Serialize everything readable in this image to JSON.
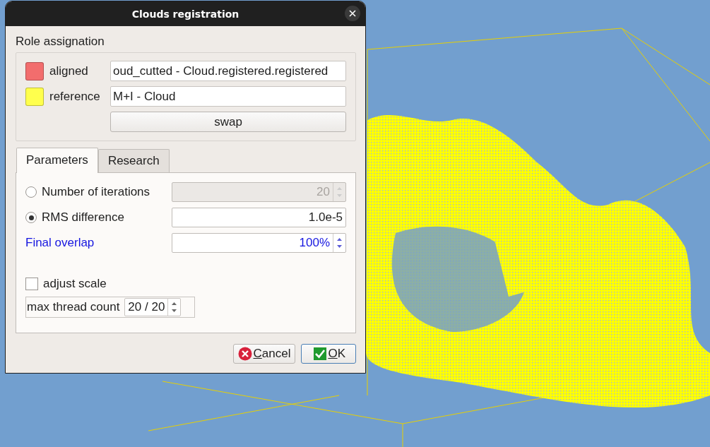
{
  "window": {
    "title": "Clouds registration"
  },
  "role_assignation": {
    "title": "Role assignation",
    "roles": [
      {
        "label": "aligned",
        "color": "#f26d6d",
        "value": "oud_cutted - Cloud.registered.registered"
      },
      {
        "label": "reference",
        "color": "#ffff4d",
        "value": "M+I - Cloud"
      }
    ],
    "swap_button": "swap"
  },
  "tabs": [
    {
      "label": "Parameters",
      "selected": true
    },
    {
      "label": "Research",
      "selected": false
    }
  ],
  "parameters": [
    {
      "kind": "radio",
      "label": "Number of iterations",
      "selected": false,
      "value": "20",
      "disabled": true,
      "spinner": true
    },
    {
      "kind": "radio",
      "label": "RMS difference",
      "selected": true,
      "value": "1.0e-5",
      "disabled": false,
      "spinner": false
    },
    {
      "kind": "highlight",
      "label": "Final overlap",
      "value": "100%",
      "disabled": false,
      "spinner": true
    }
  ],
  "adjust_scale": {
    "label": "adjust scale",
    "checked": false
  },
  "thread_count": {
    "label": "max thread count",
    "value": "20 / 20"
  },
  "buttons": [
    {
      "kind": "cancel",
      "label": "Cancel",
      "default": false
    },
    {
      "kind": "ok",
      "label": "OK",
      "default": true
    }
  ]
}
